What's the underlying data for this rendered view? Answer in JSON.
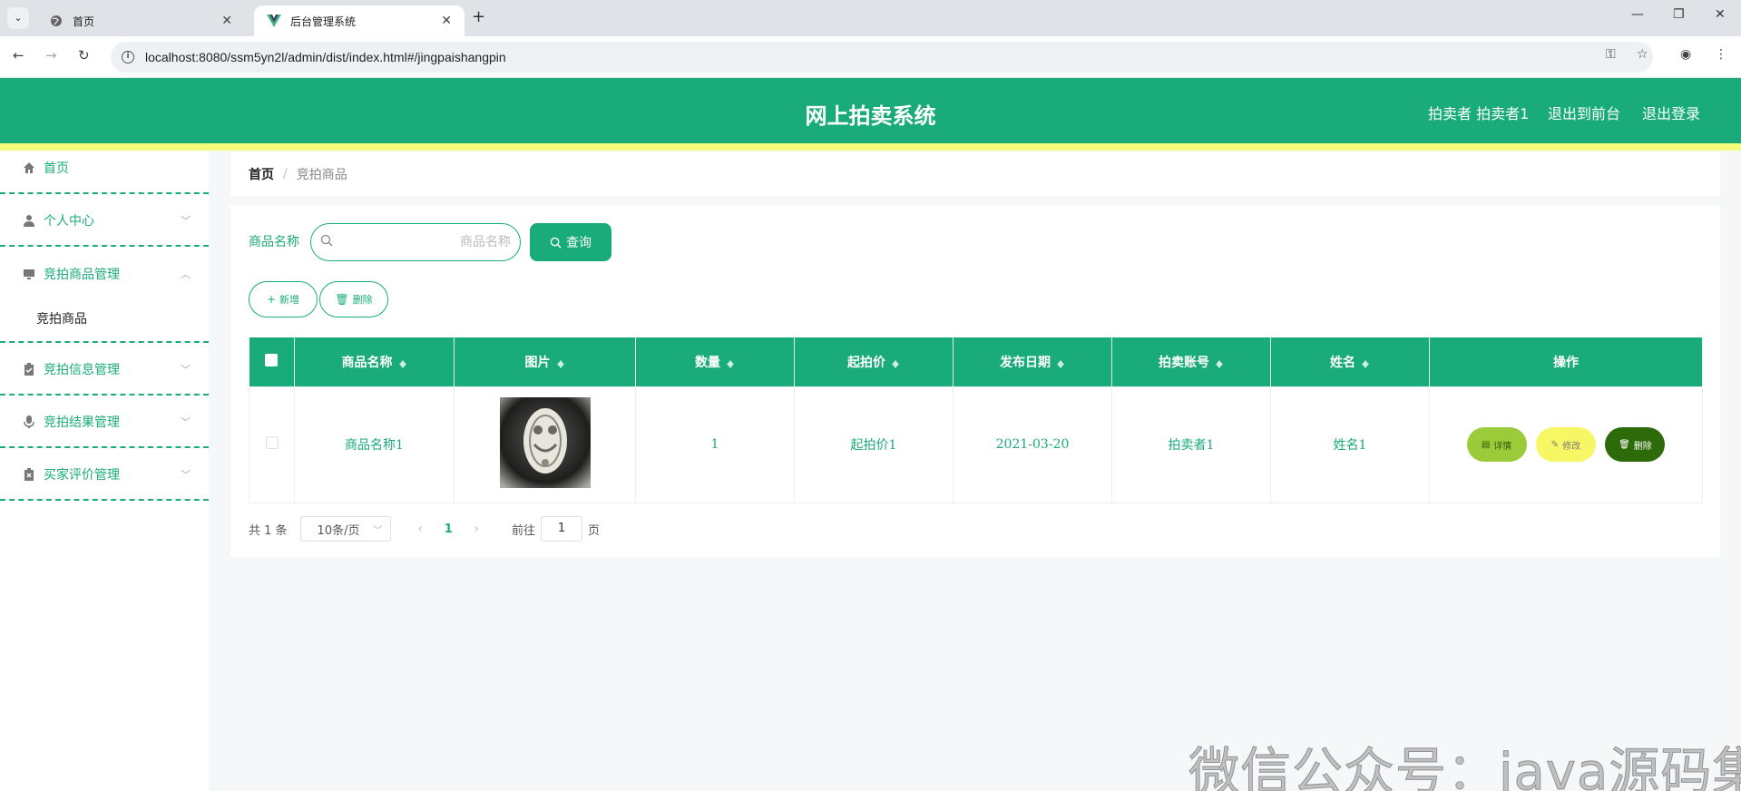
{
  "browser": {
    "tabs": [
      {
        "title": "首页",
        "active": false
      },
      {
        "title": "后台管理系统",
        "active": true
      }
    ],
    "url": "localhost:8080/ssm5yn2l/admin/dist/index.html#/jingpaishangpin"
  },
  "header": {
    "title": "网上拍卖系统",
    "user_label": "拍卖者 拍卖者1",
    "to_front_label": "退出到前台",
    "logout_label": "退出登录",
    "color": "#1aab7a",
    "strip_color": "#f4fa7a"
  },
  "sidebar": {
    "items": [
      {
        "label": "首页",
        "icon": "home-icon"
      },
      {
        "label": "个人中心",
        "icon": "user-icon"
      },
      {
        "label": "竞拍商品管理",
        "icon": "monitor-icon",
        "expanded": true,
        "children": [
          {
            "label": "竞拍商品"
          }
        ]
      },
      {
        "label": "竞拍信息管理",
        "icon": "clipboard-check-icon"
      },
      {
        "label": "竞拍结果管理",
        "icon": "microphone-icon"
      },
      {
        "label": "买家评价管理",
        "icon": "clipboard-x-icon"
      }
    ]
  },
  "breadcrumb": {
    "home": "首页",
    "separator": "/",
    "current": "竞拍商品"
  },
  "search": {
    "label": "商品名称",
    "placeholder": "商品名称",
    "query_label": "查询"
  },
  "actions": {
    "add_label": "新增",
    "delete_label": "删除"
  },
  "table": {
    "columns": [
      "商品名称",
      "图片",
      "数量",
      "起拍价",
      "发布日期",
      "拍卖账号",
      "姓名",
      "操作"
    ],
    "rows": [
      {
        "name": "商品名称1",
        "image": "jade-pendant-thumbnail",
        "quantity": "1",
        "start_price": "起拍价1",
        "date": "2021-03-20",
        "account": "拍卖者1",
        "person_name": "姓名1"
      }
    ],
    "row_actions": {
      "detail": "详情",
      "edit": "修改",
      "delete": "删除"
    }
  },
  "pagination": {
    "total": "共 1 条",
    "page_size": "10条/页",
    "current_page": "1",
    "goto_label": "前往",
    "goto_value": "1",
    "page_suffix": "页"
  },
  "watermark": "微信公众号：java源码集合"
}
